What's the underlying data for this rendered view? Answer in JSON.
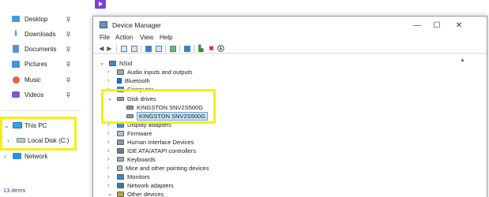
{
  "explorer": {
    "quick_access": [
      {
        "label": "Desktop",
        "icon": "desktop-folder-icon"
      },
      {
        "label": "Downloads",
        "icon": "downloads-icon"
      },
      {
        "label": "Documents",
        "icon": "documents-icon"
      },
      {
        "label": "Pictures",
        "icon": "pictures-icon"
      },
      {
        "label": "Music",
        "icon": "music-icon"
      },
      {
        "label": "Videos",
        "icon": "videos-icon"
      }
    ],
    "this_pc": "This PC",
    "local_disk": "Local Disk (C:)",
    "network": "Network",
    "status_count": "13 items"
  },
  "device_manager": {
    "title": "Device Manager",
    "menu": [
      "File",
      "Action",
      "View",
      "Help"
    ],
    "tree": {
      "root": "NSid",
      "categories": [
        {
          "label": "Audio inputs and outputs",
          "icon": "audio-icon"
        },
        {
          "label": "Bluetooth",
          "icon": "bluetooth-icon"
        },
        {
          "label": "Computer",
          "icon": "computer-icon"
        },
        {
          "label": "Disk drives",
          "icon": "disk-drive-icon",
          "expanded": true,
          "children": [
            "KINGSTON SNV2S500G",
            "KINGSTON SNV2S500G"
          ]
        },
        {
          "label": "Display adapters",
          "icon": "display-adapter-icon"
        },
        {
          "label": "Firmware",
          "icon": "firmware-icon"
        },
        {
          "label": "Human Interface Devices",
          "icon": "hid-icon"
        },
        {
          "label": "IDE ATA/ATAPI controllers",
          "icon": "ide-icon"
        },
        {
          "label": "Keyboards",
          "icon": "keyboard-icon"
        },
        {
          "label": "Mice and other pointing devices",
          "icon": "mouse-icon"
        },
        {
          "label": "Monitors",
          "icon": "monitor-icon"
        },
        {
          "label": "Network adapters",
          "icon": "network-adapter-icon"
        },
        {
          "label": "Other devices",
          "icon": "other-devices-icon"
        }
      ]
    }
  },
  "colors": {
    "highlight": "#f6ee13",
    "selection": "#cce4f7",
    "accent": "#0067c0"
  }
}
